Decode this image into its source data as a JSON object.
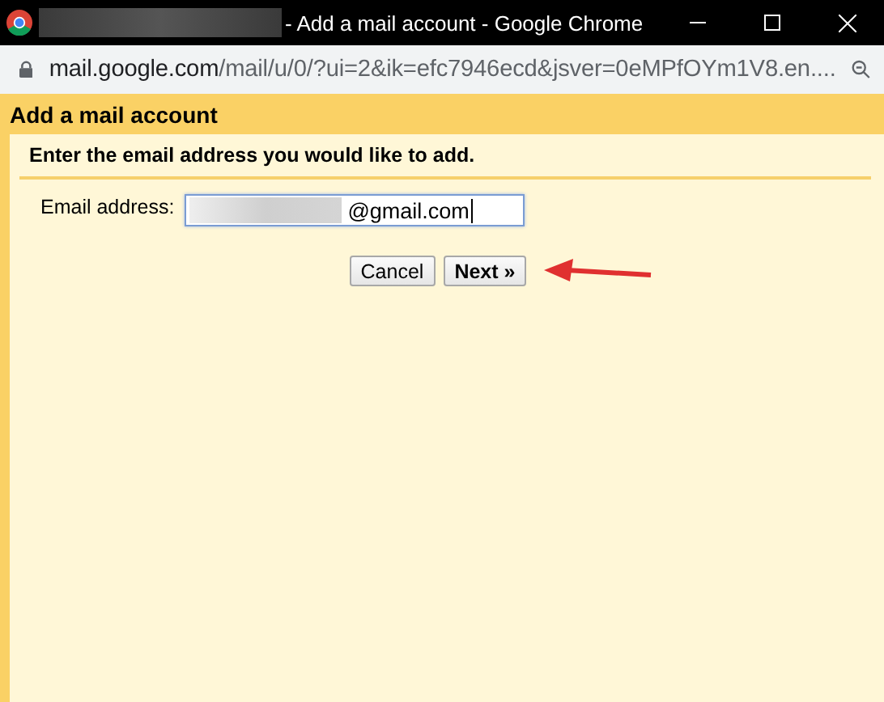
{
  "window": {
    "title": "- Add a mail account - Google Chrome"
  },
  "address_bar": {
    "host": "mail.google.com",
    "path": "/mail/u/0/?ui=2&ik=efc7946ecd&jsver=0eMPfOYm1V8.en...."
  },
  "dialog": {
    "title": "Add a mail account",
    "instruction": "Enter the email address you would like to add.",
    "email_field": {
      "label": "Email address:",
      "value": "@gmail.com"
    },
    "buttons": [
      {
        "label": "Cancel",
        "kind": "secondary"
      },
      {
        "label": "Next »",
        "kind": "primary"
      }
    ]
  }
}
